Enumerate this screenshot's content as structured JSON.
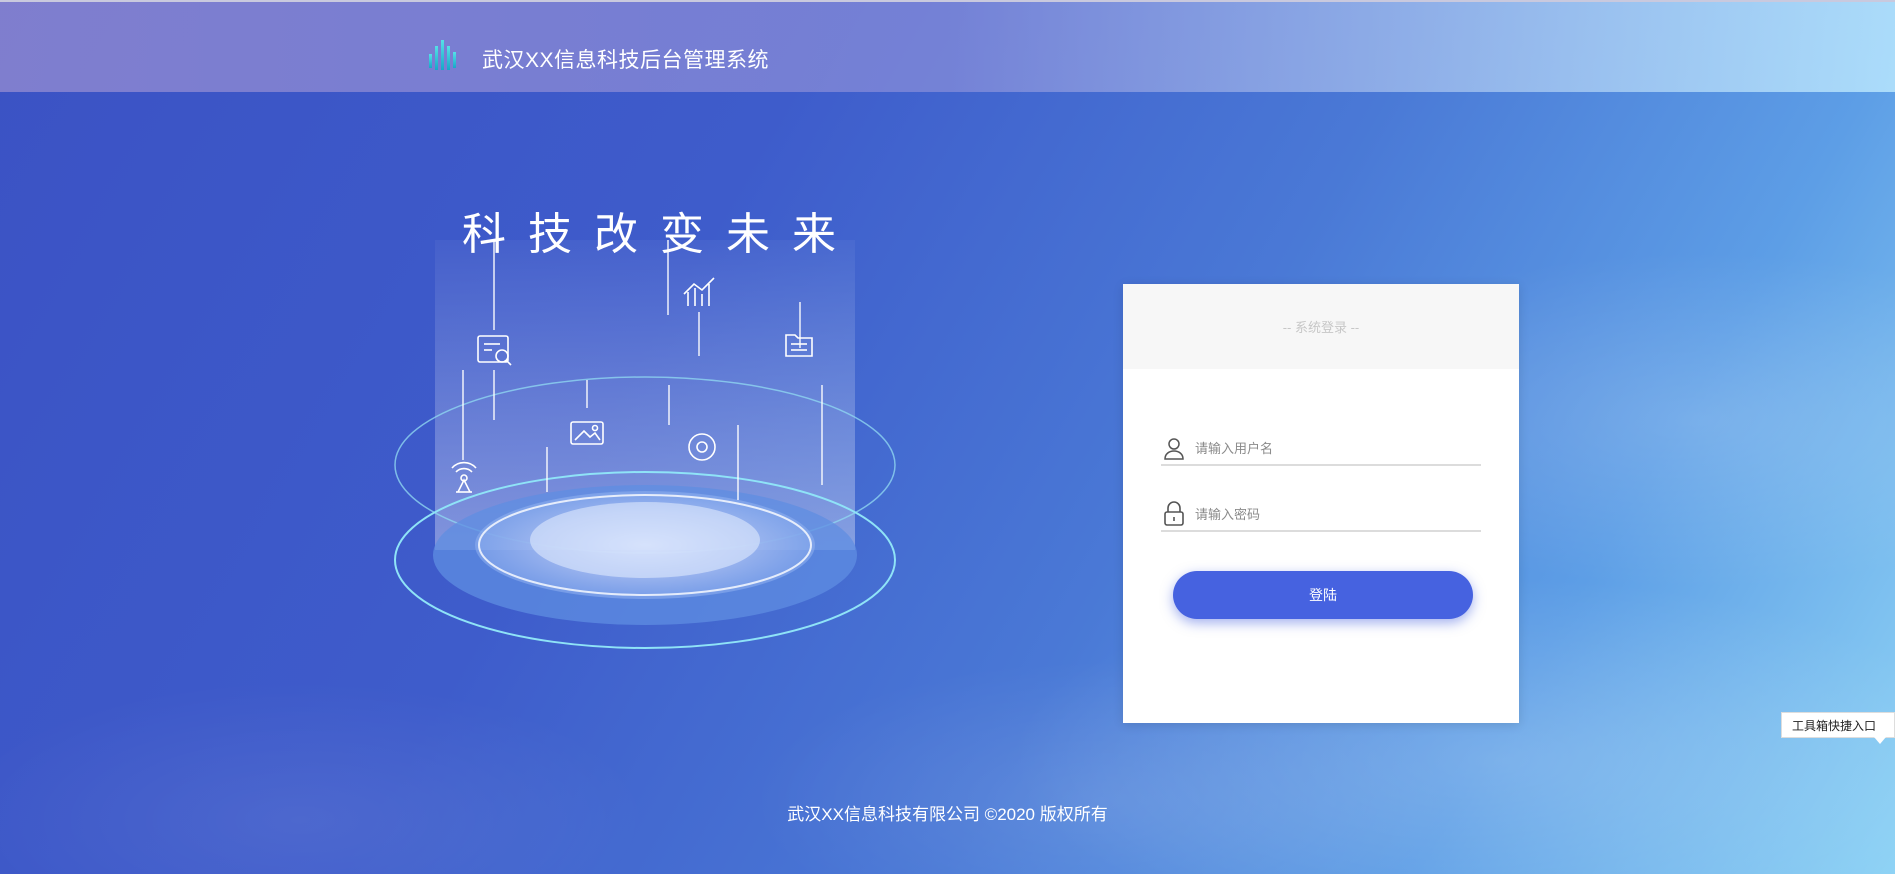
{
  "header": {
    "title": "武汉XX信息科技后台管理系统",
    "logo_icon": "bar-chart-logo-icon"
  },
  "hero": {
    "slogan": "科技改变未来",
    "icons": [
      "document-search-icon",
      "trend-chart-icon",
      "folder-icon",
      "image-icon",
      "settings-icon",
      "signal-tower-icon"
    ]
  },
  "login": {
    "title": "-- 系统登录 --",
    "username_placeholder": "请输入用户名",
    "password_placeholder": "请输入密码",
    "submit_label": "登陆",
    "user_icon": "user-icon",
    "lock_icon": "lock-icon",
    "accent_color": "#4662e0"
  },
  "footer": {
    "copyright": "武汉XX信息科技有限公司 ©2020 版权所有"
  },
  "toolbox": {
    "label": "工具箱快捷入口"
  }
}
